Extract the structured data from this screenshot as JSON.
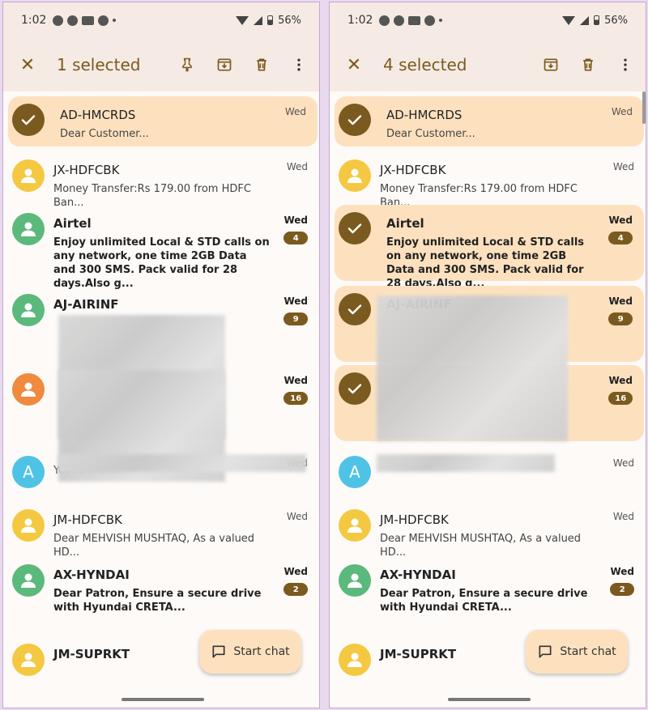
{
  "status": {
    "time": "1:02",
    "battery": "56%"
  },
  "colors": {
    "accent": "#7a5a1e",
    "selected_bg": "#fde1bf",
    "yellow": "#f5c842",
    "green": "#5bb97b",
    "orange": "#f08a3e",
    "blue": "#4fc3e6"
  },
  "left": {
    "title": "1 selected",
    "close_icon": "close-icon",
    "fab_label": "Start chat",
    "rows": [
      {
        "sender": "AD-HMCRDS",
        "preview": "Dear Customer...",
        "day": "Wed",
        "badge": "",
        "bold": false,
        "selected": true,
        "avatar_color": "#7a5a1e",
        "avatar": "check"
      },
      {
        "sender": "JX-HDFCBK",
        "preview": "Money Transfer:Rs 179.00 from HDFC Ban...",
        "day": "Wed",
        "badge": "",
        "bold": false,
        "selected": false,
        "avatar_color": "#f5c842",
        "avatar": "person"
      },
      {
        "sender": "Airtel",
        "preview": "Enjoy unlimited Local & STD calls on any network, one time 2GB Data and 300 SMS. Pack valid for 28 days.Also g...",
        "day": "Wed",
        "badge": "4",
        "bold": true,
        "selected": false,
        "avatar_color": "#5bb97b",
        "avatar": "person"
      },
      {
        "sender": "AJ-AIRINF",
        "preview": "",
        "day": "Wed",
        "badge": "9",
        "bold": true,
        "selected": false,
        "avatar_color": "#5bb97b",
        "avatar": "person"
      },
      {
        "sender": "",
        "preview": "",
        "day": "Wed",
        "badge": "16",
        "bold": true,
        "selected": false,
        "avatar_color": "#f08a3e",
        "avatar": "person"
      },
      {
        "sender": "",
        "preview": "You: 144342",
        "day": "Wed",
        "badge": "",
        "bold": false,
        "selected": false,
        "avatar_color": "#4fc3e6",
        "avatar": "A"
      },
      {
        "sender": "JM-HDFCBK",
        "preview": "Dear MEHVISH MUSHTAQ, As a valued HD...",
        "day": "Wed",
        "badge": "",
        "bold": false,
        "selected": false,
        "avatar_color": "#f5c842",
        "avatar": "person"
      },
      {
        "sender": "AX-HYNDAI",
        "preview": "Dear Patron, Ensure a secure drive with Hyundai CRETA...",
        "day": "Wed",
        "badge": "2",
        "bold": true,
        "selected": false,
        "avatar_color": "#5bb97b",
        "avatar": "person"
      },
      {
        "sender": "JM-SUPRKT",
        "preview": "",
        "day": "",
        "badge": "",
        "bold": true,
        "selected": false,
        "avatar_color": "#f5c842",
        "avatar": "person"
      }
    ]
  },
  "right": {
    "title": "4 selected",
    "close_icon": "close-icon",
    "fab_label": "Start chat",
    "rows": [
      {
        "sender": "AD-HMCRDS",
        "preview": "Dear Customer...",
        "day": "Wed",
        "badge": "",
        "bold": false,
        "selected": true,
        "avatar_color": "#7a5a1e",
        "avatar": "check"
      },
      {
        "sender": "JX-HDFCBK",
        "preview": "Money Transfer:Rs 179.00 from HDFC Ban...",
        "day": "Wed",
        "badge": "",
        "bold": false,
        "selected": false,
        "avatar_color": "#f5c842",
        "avatar": "person"
      },
      {
        "sender": "Airtel",
        "preview": "Enjoy unlimited Local & STD calls on any network, one time 2GB Data and 300 SMS. Pack valid for 28 days.Also g...",
        "day": "Wed",
        "badge": "4",
        "bold": true,
        "selected": true,
        "avatar_color": "#7a5a1e",
        "avatar": "check"
      },
      {
        "sender": "AJ-AIRINF",
        "preview": "",
        "day": "Wed",
        "badge": "9",
        "bold": true,
        "selected": true,
        "avatar_color": "#7a5a1e",
        "avatar": "check"
      },
      {
        "sender": "",
        "preview": "",
        "day": "Wed",
        "badge": "16",
        "bold": true,
        "selected": true,
        "avatar_color": "#7a5a1e",
        "avatar": "check"
      },
      {
        "sender": "",
        "preview": "",
        "day": "Wed",
        "badge": "",
        "bold": false,
        "selected": false,
        "avatar_color": "#4fc3e6",
        "avatar": "A"
      },
      {
        "sender": "JM-HDFCBK",
        "preview": "Dear MEHVISH MUSHTAQ, As a valued HD...",
        "day": "Wed",
        "badge": "",
        "bold": false,
        "selected": false,
        "avatar_color": "#f5c842",
        "avatar": "person"
      },
      {
        "sender": "AX-HYNDAI",
        "preview": "Dear Patron, Ensure a secure drive with Hyundai CRETA...",
        "day": "Wed",
        "badge": "2",
        "bold": true,
        "selected": false,
        "avatar_color": "#5bb97b",
        "avatar": "person"
      },
      {
        "sender": "JM-SUPRKT",
        "preview": "",
        "day": "",
        "badge": "",
        "bold": true,
        "selected": false,
        "avatar_color": "#f5c842",
        "avatar": "person"
      }
    ]
  }
}
